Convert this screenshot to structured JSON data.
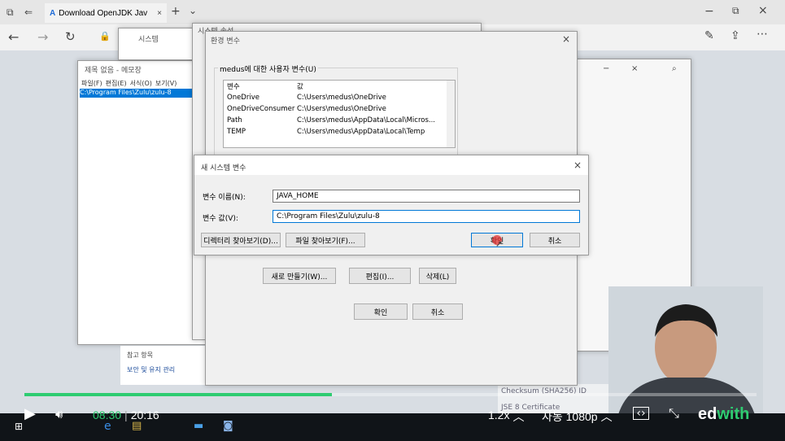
{
  "browser": {
    "tab_title": "Download OpenJDK Jav",
    "tab_close": "×",
    "new_tab": "+",
    "tab_menu": "⌄",
    "win_minimize": "−",
    "win_restore": "⧉",
    "win_close": "×"
  },
  "sys_window": {
    "title": "시스템"
  },
  "sysprop_window": {
    "title": "시스템 속성"
  },
  "notepad": {
    "title": "제목 없음 - 메모장",
    "menu": [
      "파일(F)",
      "편집(E)",
      "서식(O)",
      "보기(V)"
    ],
    "content": "C:\\Program Files\\Zulu\\zulu-8"
  },
  "env_dialog": {
    "title": "환경 변수",
    "user_group_label": "medus에 대한 사용자 변수(U)",
    "col_var": "변수",
    "col_val": "값",
    "rows": [
      {
        "name": "OneDrive",
        "value": "C:\\Users\\medus\\OneDrive"
      },
      {
        "name": "OneDriveConsumer",
        "value": "C:\\Users\\medus\\OneDrive"
      },
      {
        "name": "Path",
        "value": "C:\\Users\\medus\\AppData\\Local\\Micros..."
      },
      {
        "name": "TEMP",
        "value": "C:\\Users\\medus\\AppData\\Local\\Temp"
      }
    ],
    "new_btn": "새로 만들기(W)...",
    "edit_btn": "편집(I)...",
    "delete_btn": "삭제(L)",
    "ok_btn": "확인",
    "cancel_btn": "취소"
  },
  "new_var_dialog": {
    "title": "새 시스템 변수",
    "name_label": "변수 이름(N):",
    "name_value": "JAVA_HOME",
    "value_label": "변수 값(V):",
    "value_value": "C:\\Program Files\\Zulu\\zulu-8",
    "browse_dir_btn": "디렉터리 찾아보기(D)...",
    "browse_file_btn": "파일 찾아보기(F)...",
    "ok_btn": "확인",
    "cancel_btn": "취소"
  },
  "control_panel": {
    "items": [
      "참고 항목",
      "보안 및 유지 관리"
    ]
  },
  "webpage_bits": {
    "checksum": "Checksum (SHA256) ID",
    "jse": "JSE 8 Certificate"
  },
  "player": {
    "current_time": "08:30",
    "separator": "|",
    "duration": "20:16",
    "progress": 0.42,
    "speed": "1.2x",
    "quality": "자동 1080p",
    "brand_prefix": "ed",
    "brand_suffix": "with"
  },
  "colors": {
    "accent_green": "#2ecc71",
    "selection_blue": "#0078d7"
  }
}
